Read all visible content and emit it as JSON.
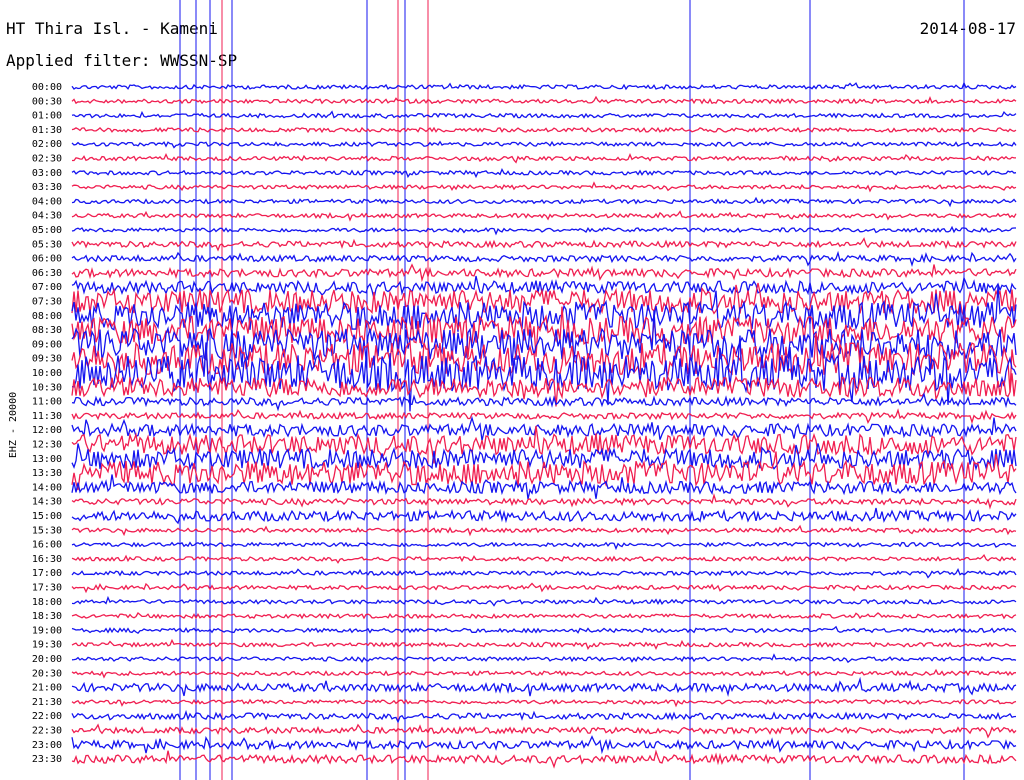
{
  "header": {
    "station": "HT Thira Isl. - Kameni",
    "filter": "Applied filter: WWSSN-SP",
    "date": "2014-08-17"
  },
  "colors": {
    "blue": "#1414f0",
    "red": "#f01e50"
  },
  "chart_data": {
    "type": "line",
    "channel_label": "EHZ - 20000",
    "row_minutes": 30,
    "rows": [
      {
        "label": "00:00",
        "color": "blue",
        "amp": 2
      },
      {
        "label": "00:30",
        "color": "red",
        "amp": 2
      },
      {
        "label": "01:00",
        "color": "blue",
        "amp": 2
      },
      {
        "label": "01:30",
        "color": "red",
        "amp": 2
      },
      {
        "label": "02:00",
        "color": "blue",
        "amp": 2
      },
      {
        "label": "02:30",
        "color": "red",
        "amp": 2
      },
      {
        "label": "03:00",
        "color": "blue",
        "amp": 2
      },
      {
        "label": "03:30",
        "color": "red",
        "amp": 2
      },
      {
        "label": "04:00",
        "color": "blue",
        "amp": 2
      },
      {
        "label": "04:30",
        "color": "red",
        "amp": 2
      },
      {
        "label": "05:00",
        "color": "blue",
        "amp": 2
      },
      {
        "label": "05:30",
        "color": "red",
        "amp": 3
      },
      {
        "label": "06:00",
        "color": "blue",
        "amp": 3
      },
      {
        "label": "06:30",
        "color": "red",
        "amp": 4
      },
      {
        "label": "07:00",
        "color": "blue",
        "amp": 6
      },
      {
        "label": "07:30",
        "color": "red",
        "amp": 12
      },
      {
        "label": "08:00",
        "color": "blue",
        "amp": 14
      },
      {
        "label": "08:30",
        "color": "red",
        "amp": 14
      },
      {
        "label": "09:00",
        "color": "blue",
        "amp": 16
      },
      {
        "label": "09:30",
        "color": "red",
        "amp": 16
      },
      {
        "label": "10:00",
        "color": "blue",
        "amp": 18
      },
      {
        "label": "10:30",
        "color": "red",
        "amp": 10
      },
      {
        "label": "11:00",
        "color": "blue",
        "amp": 4
      },
      {
        "label": "11:30",
        "color": "red",
        "amp": 3
      },
      {
        "label": "12:00",
        "color": "blue",
        "amp": 6
      },
      {
        "label": "12:30",
        "color": "red",
        "amp": 10
      },
      {
        "label": "13:00",
        "color": "blue",
        "amp": 10
      },
      {
        "label": "13:30",
        "color": "red",
        "amp": 12
      },
      {
        "label": "14:00",
        "color": "blue",
        "amp": 6
      },
      {
        "label": "14:30",
        "color": "red",
        "amp": 3
      },
      {
        "label": "15:00",
        "color": "blue",
        "amp": 5
      },
      {
        "label": "15:30",
        "color": "red",
        "amp": 2
      },
      {
        "label": "16:00",
        "color": "blue",
        "amp": 2
      },
      {
        "label": "16:30",
        "color": "red",
        "amp": 2
      },
      {
        "label": "17:00",
        "color": "blue",
        "amp": 2
      },
      {
        "label": "17:30",
        "color": "red",
        "amp": 2
      },
      {
        "label": "18:00",
        "color": "blue",
        "amp": 2
      },
      {
        "label": "18:30",
        "color": "red",
        "amp": 2
      },
      {
        "label": "19:00",
        "color": "blue",
        "amp": 2
      },
      {
        "label": "19:30",
        "color": "red",
        "amp": 2
      },
      {
        "label": "20:00",
        "color": "blue",
        "amp": 2
      },
      {
        "label": "20:30",
        "color": "red",
        "amp": 2
      },
      {
        "label": "21:00",
        "color": "blue",
        "amp": 4
      },
      {
        "label": "21:30",
        "color": "red",
        "amp": 2
      },
      {
        "label": "22:00",
        "color": "blue",
        "amp": 3
      },
      {
        "label": "22:30",
        "color": "red",
        "amp": 3
      },
      {
        "label": "23:00",
        "color": "blue",
        "amp": 4
      },
      {
        "label": "23:30",
        "color": "red",
        "amp": 4
      }
    ]
  }
}
